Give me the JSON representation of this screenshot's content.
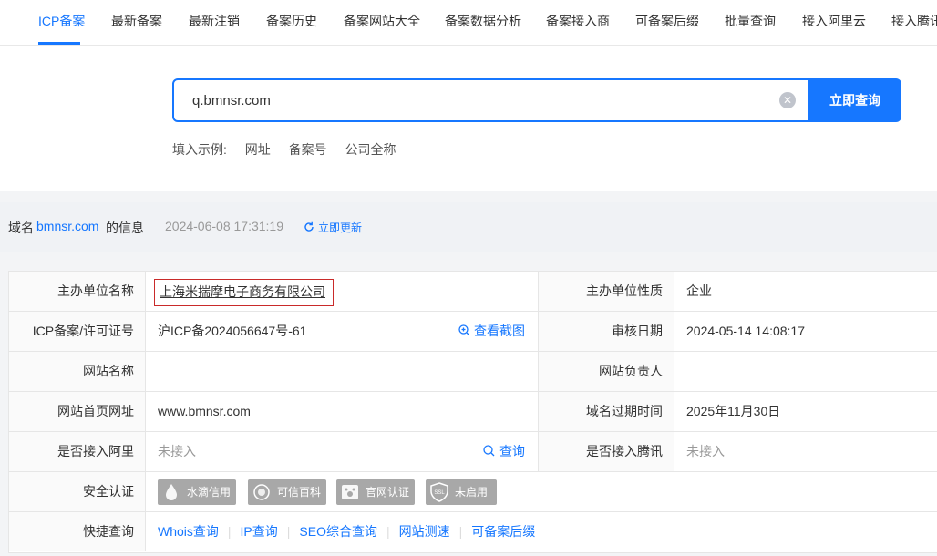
{
  "nav": {
    "tabs": [
      {
        "label": "ICP备案",
        "active": true
      },
      {
        "label": "最新备案"
      },
      {
        "label": "最新注销"
      },
      {
        "label": "备案历史"
      },
      {
        "label": "备案网站大全"
      },
      {
        "label": "备案数据分析"
      },
      {
        "label": "备案接入商"
      },
      {
        "label": "可备案后缀"
      },
      {
        "label": "批量查询"
      },
      {
        "label": "接入阿里云"
      },
      {
        "label": "接入腾讯"
      }
    ]
  },
  "search": {
    "value": "q.bmnsr.com",
    "button_label": "立即查询",
    "examples_label": "填入示例:",
    "examples": [
      "网址",
      "备案号",
      "公司全称"
    ]
  },
  "info": {
    "prefix": "域名",
    "domain": "bmnsr.com",
    "suffix": "的信息",
    "timestamp": "2024-06-08 17:31:19",
    "refresh_label": "立即更新"
  },
  "record": {
    "rows": [
      {
        "label": "主办单位名称",
        "value": "上海米揣摩电子商务有限公司",
        "label2": "主办单位性质",
        "value2": "企业"
      },
      {
        "label": "ICP备案/许可证号",
        "value": "沪ICP备2024056647号-61",
        "action": "查看截图",
        "label2": "审核日期",
        "value2": "2024-05-14 14:08:17"
      },
      {
        "label": "网站名称",
        "value": "",
        "label2": "网站负责人",
        "value2": ""
      },
      {
        "label": "网站首页网址",
        "value": "www.bmnsr.com",
        "label2": "域名过期时间",
        "value2": "2025年11月30日"
      },
      {
        "label": "是否接入阿里",
        "value": "未接入",
        "action": "查询",
        "label2": "是否接入腾讯",
        "value2": "未接入"
      },
      {
        "label": "安全认证"
      },
      {
        "label": "快捷查询"
      }
    ],
    "badges": [
      "水滴信用",
      "可信百科",
      "官网认证",
      "未启用"
    ],
    "quick_links": [
      "Whois查询",
      "IP查询",
      "SEO综合查询",
      "网站测速",
      "可备案后缀"
    ]
  },
  "colors": {
    "accent": "#1677ff",
    "highlight_box": "#c92a2a",
    "badge_gray": "#a8a8a8"
  }
}
